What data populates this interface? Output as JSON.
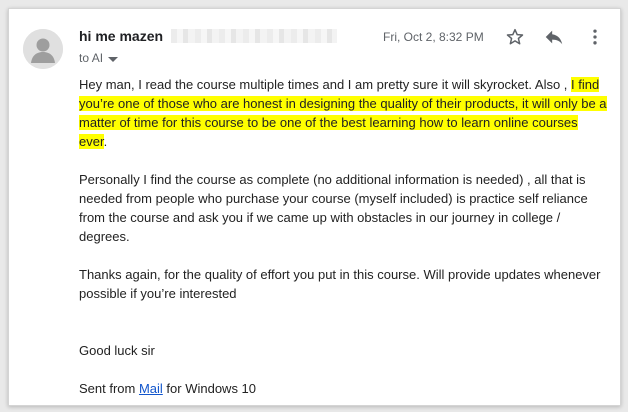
{
  "header": {
    "sender_name": "hi me mazen",
    "recipient_prefix": "to",
    "recipient": "AI",
    "date": "Fri, Oct 2, 8:32 PM",
    "icons": {
      "avatar": "person-avatar-icon",
      "star": "star-icon",
      "reply": "reply-icon",
      "more": "more-vertical-icon",
      "details": "caret-down-icon"
    }
  },
  "body": {
    "p1_plain": "Hey man, I read the course multiple times and I  am pretty sure it will skyrocket. Also , ",
    "p1_highlight": "I find you’re one of those who are honest in designing the quality of their products, it will only be a matter of time for this  course to be one of the best learning how to learn online courses ever",
    "p1_end": ".",
    "p2": "Personally I find the course as complete (no additional information is needed) , all that is needed from people who purchase your course (myself included) is practice self reliance from the course and ask you if we came up with obstacles in our journey in college / degrees.",
    "p3": "Thanks again, for the quality of effort you put in this course. Will provide updates whenever possible if you’re interested",
    "p4": "Good luck sir",
    "signature_prefix": "Sent from ",
    "signature_link": "Mail",
    "signature_suffix": " for Windows 10"
  },
  "colors": {
    "highlight": "#ffff00",
    "link": "#1155cc",
    "text": "#222222",
    "muted": "#5f6368"
  }
}
